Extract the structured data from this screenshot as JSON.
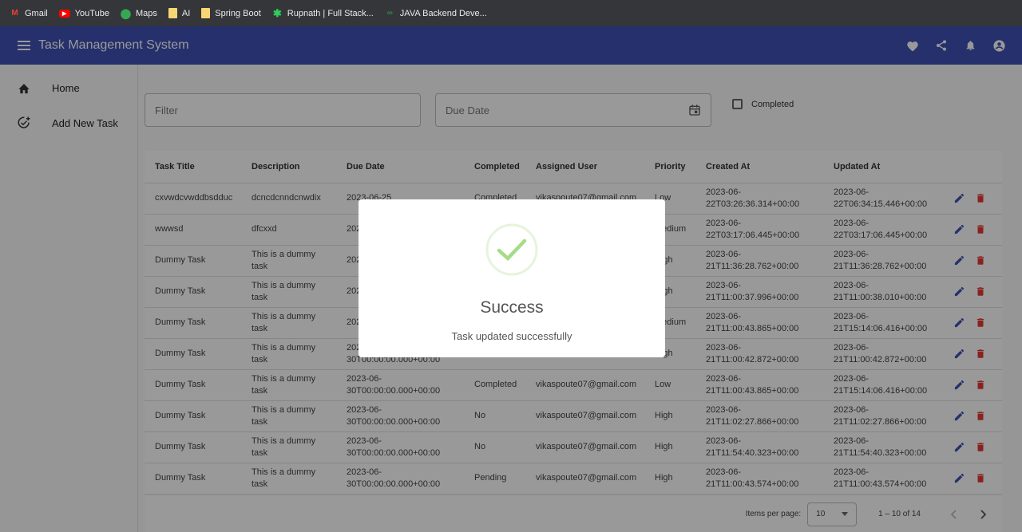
{
  "bookmarks": [
    {
      "label": "Gmail",
      "icon": "gmail-icon"
    },
    {
      "label": "YouTube",
      "icon": "youtube-icon"
    },
    {
      "label": "Maps",
      "icon": "maps-icon"
    },
    {
      "label": "AI",
      "icon": "folder-icon"
    },
    {
      "label": "Spring Boot",
      "icon": "folder-icon"
    },
    {
      "label": "Rupnath | Full Stack...",
      "icon": "star-icon"
    },
    {
      "label": "JAVA Backend Deve...",
      "icon": "gfg-icon"
    }
  ],
  "appbar": {
    "title": "Task Management System",
    "color": "#3f51b5",
    "actions": [
      "heart-icon",
      "share-icon",
      "bell-icon",
      "account-icon"
    ]
  },
  "sidebar": {
    "items": [
      {
        "label": "Home",
        "icon": "home-icon"
      },
      {
        "label": "Add New Task",
        "icon": "add-task-icon"
      }
    ]
  },
  "filters": {
    "filter_placeholder": "Filter",
    "due_date_placeholder": "Due Date",
    "completed_label": "Completed"
  },
  "table": {
    "headers": [
      "Task Title",
      "Description",
      "Due Date",
      "Completed",
      "Assigned User",
      "Priority",
      "Created At",
      "Updated At"
    ],
    "rows": [
      {
        "title": "cxvwdcvwddbsdduc",
        "description": "dcncdcnndcnwdix",
        "due": "2023-06-25",
        "completed": "Completed",
        "user": "vikaspoute07@gmail.com",
        "priority": "Low",
        "created": "2023-06-22T03:26:36.314+00:00",
        "updated": "2023-06-22T06:34:15.446+00:00"
      },
      {
        "title": "wwwsd",
        "description": "dfcxxd",
        "due": "2023-06-29",
        "completed": "",
        "user": "",
        "priority": "Medium",
        "created": "2023-06-22T03:17:06.445+00:00",
        "updated": "2023-06-22T03:17:06.445+00:00"
      },
      {
        "title": "Dummy Task",
        "description": "This is a dummy task",
        "due": "2023-06-30",
        "completed": "",
        "user": "",
        "priority": "High",
        "created": "2023-06-21T11:36:28.762+00:00",
        "updated": "2023-06-21T11:36:28.762+00:00"
      },
      {
        "title": "Dummy Task",
        "description": "This is a dummy task",
        "due": "2023-06-30",
        "completed": "",
        "user": "",
        "priority": "High",
        "created": "2023-06-21T11:00:37.996+00:00",
        "updated": "2023-06-21T11:00:38.010+00:00"
      },
      {
        "title": "Dummy Task",
        "description": "This is a dummy task",
        "due": "2023-06-30",
        "completed": "",
        "user": "",
        "priority": "Medium",
        "created": "2023-06-21T11:00:43.865+00:00",
        "updated": "2023-06-21T15:14:06.416+00:00"
      },
      {
        "title": "Dummy Task",
        "description": "This is a dummy task",
        "due": "2023-06-30T00:00:00.000+00:00",
        "completed": "",
        "user": "",
        "priority": "High",
        "created": "2023-06-21T11:00:42.872+00:00",
        "updated": "2023-06-21T11:00:42.872+00:00"
      },
      {
        "title": "Dummy Task",
        "description": "This is a dummy task",
        "due": "2023-06-30T00:00:00.000+00:00",
        "completed": "Completed",
        "user": "vikaspoute07@gmail.com",
        "priority": "Low",
        "created": "2023-06-21T11:00:43.865+00:00",
        "updated": "2023-06-21T15:14:06.416+00:00"
      },
      {
        "title": "Dummy Task",
        "description": "This is a dummy task",
        "due": "2023-06-30T00:00:00.000+00:00",
        "completed": "No",
        "user": "vikaspoute07@gmail.com",
        "priority": "High",
        "created": "2023-06-21T11:02:27.866+00:00",
        "updated": "2023-06-21T11:02:27.866+00:00"
      },
      {
        "title": "Dummy Task",
        "description": "This is a dummy task",
        "due": "2023-06-30T00:00:00.000+00:00",
        "completed": "No",
        "user": "vikaspoute07@gmail.com",
        "priority": "High",
        "created": "2023-06-21T11:54:40.323+00:00",
        "updated": "2023-06-21T11:54:40.323+00:00"
      },
      {
        "title": "Dummy Task",
        "description": "This is a dummy task",
        "due": "2023-06-30T00:00:00.000+00:00",
        "completed": "Pending",
        "user": "vikaspoute07@gmail.com",
        "priority": "High",
        "created": "2023-06-21T11:00:43.574+00:00",
        "updated": "2023-06-21T11:00:43.574+00:00"
      }
    ]
  },
  "paginator": {
    "items_per_page_label": "Items per page:",
    "page_size": "10",
    "range_label": "1 – 10 of 14"
  },
  "modal": {
    "title": "Success",
    "message": "Task updated successfully",
    "icon": "success-check-icon",
    "accent": "#a5dc86"
  }
}
